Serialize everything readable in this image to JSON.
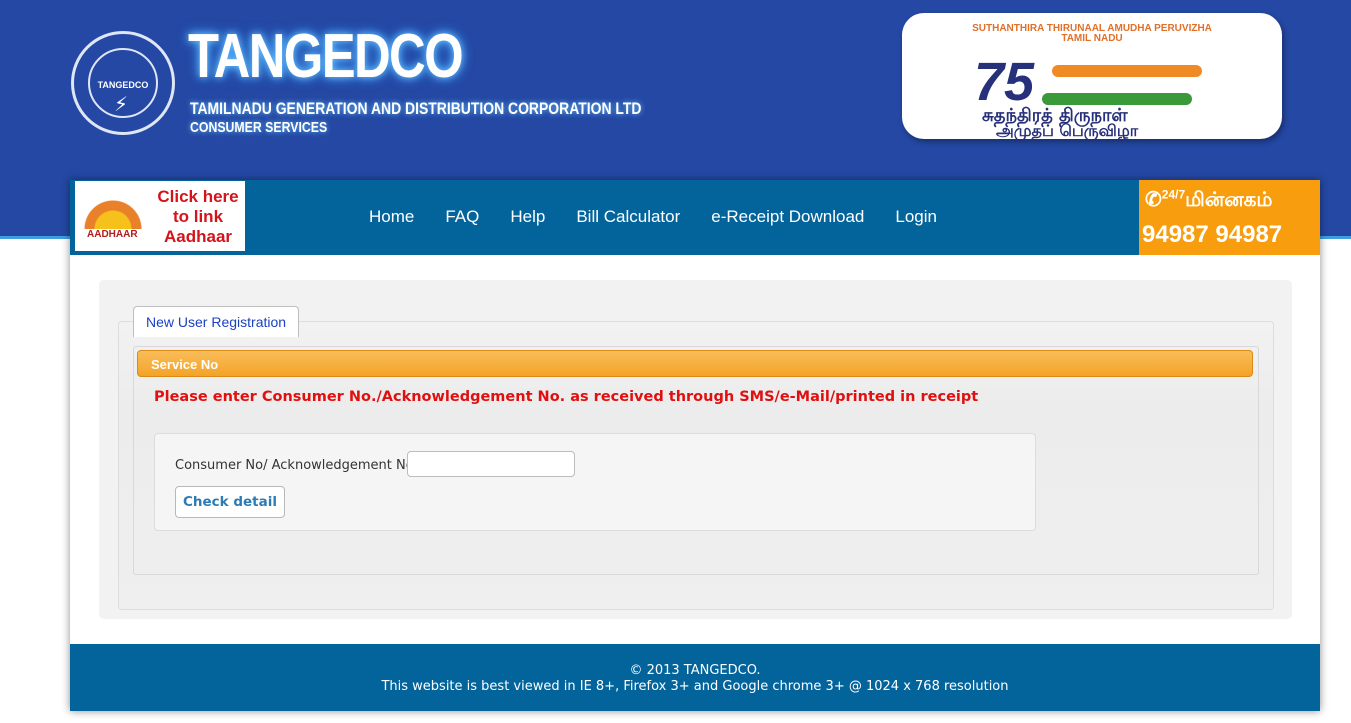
{
  "header": {
    "logo_text": "TANGEDCO",
    "brand_title": "TANGEDCO",
    "brand_subtitle": "TAMILNADU GENERATION AND DISTRIBUTION CORPORATION LTD",
    "brand_tagline": "CONSUMER SERVICES"
  },
  "badge": {
    "line1": "SUTHANTHIRA THIRUNAAL  AMUDHA PERUVIZHA",
    "line2": "TAMIL NADU",
    "number": "75",
    "tamil_line1": "சுதந்திரத் திருநாள்",
    "tamil_line2": "அமுதப் பெருவிழா"
  },
  "aadhaar": {
    "mark": "AADHAAR",
    "link_text": "Click here to link Aadhaar"
  },
  "nav": {
    "home": "Home",
    "faq": "FAQ",
    "help": "Help",
    "bill_calculator": "Bill Calculator",
    "ereceipt": "e-Receipt Download",
    "login": "Login"
  },
  "helpline": {
    "tag": "24/7",
    "title": "மின்னகம்",
    "number": "94987 94987"
  },
  "form": {
    "tab_label": "New User Registration",
    "section_title": "Service No",
    "instruction": "Please enter Consumer No./Acknowledgement No. as received through SMS/e-Mail/printed in receipt",
    "field_label": "Consumer No/ Acknowledgement No",
    "field_value": "",
    "button_label": "Check detail"
  },
  "footer": {
    "copyright": "© 2013 TANGEDCO.",
    "note": "This website is best viewed in IE 8+, Firefox 3+ and Google chrome 3+ @ 1024 x 768 resolution"
  },
  "colors": {
    "header_bg": "#2448a4",
    "nav_bg": "#03649c",
    "helpline_bg": "#f89d0e",
    "section_header": "#f3a326",
    "instruction_text": "#e01010"
  }
}
